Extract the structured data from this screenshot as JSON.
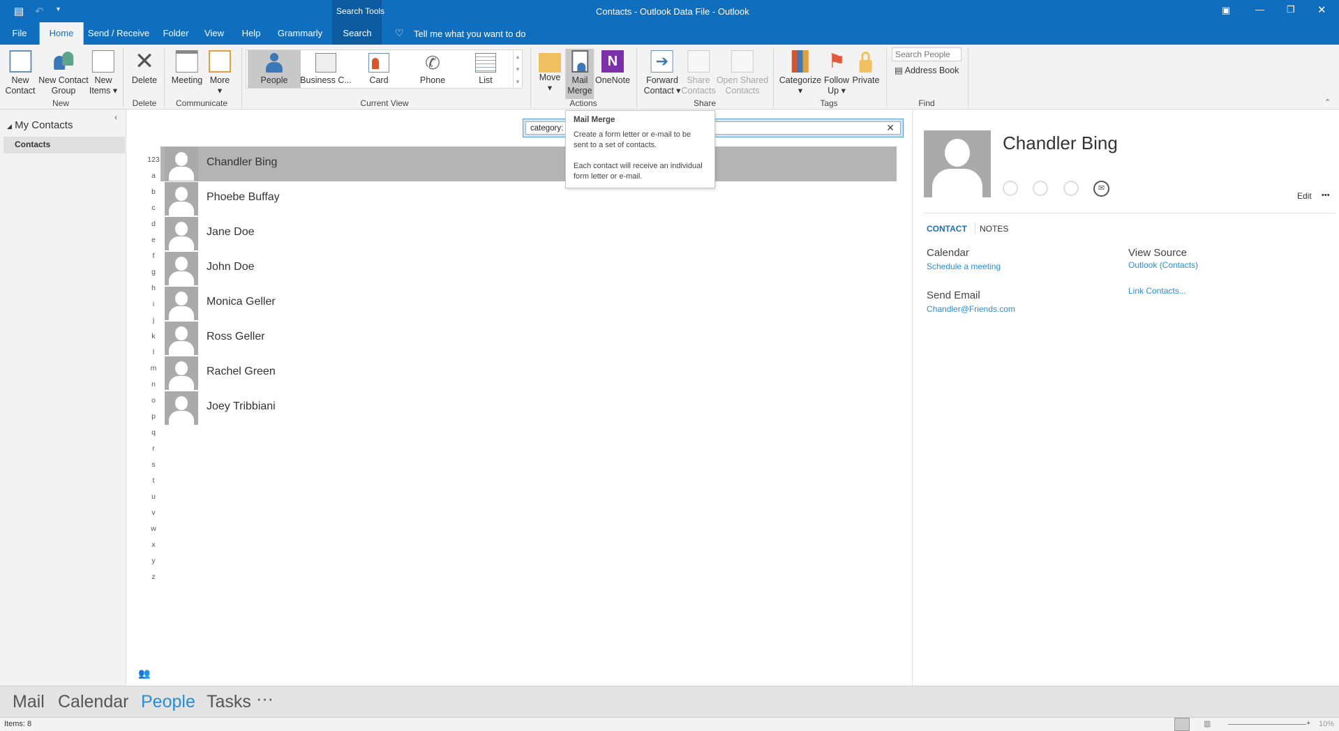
{
  "window": {
    "title": "Contacts - Outlook Data File  -  Outlook",
    "context_tab_group": "Search Tools"
  },
  "tabs": [
    {
      "label": "File"
    },
    {
      "label": "Home"
    },
    {
      "label": "Send / Receive"
    },
    {
      "label": "Folder"
    },
    {
      "label": "View"
    },
    {
      "label": "Help"
    },
    {
      "label": "Grammarly"
    },
    {
      "label": "Search"
    }
  ],
  "tell_me": "Tell me what you want to do",
  "ribbon": {
    "new": {
      "new_contact": "New\nContact",
      "new_contact_group": "New Contact\nGroup",
      "new_items": "New\nItems ▾",
      "label": "New"
    },
    "delete": {
      "delete": "Delete",
      "label": "Delete"
    },
    "communicate": {
      "meeting": "Meeting",
      "more": "More\n▾",
      "label": "Communicate"
    },
    "current_view": {
      "items": [
        "People",
        "Business C...",
        "Card",
        "Phone",
        "List"
      ],
      "selected": "People",
      "label": "Current View"
    },
    "actions": {
      "move": "Move\n▾",
      "mail_merge": "Mail\nMerge",
      "onenote": "OneNote",
      "label": "Actions"
    },
    "share": {
      "forward_contact": "Forward\nContact ▾",
      "share_contacts": "Share\nContacts",
      "open_shared": "Open Shared\nContacts",
      "label": "Share"
    },
    "tags": {
      "categorize": "Categorize\n▾",
      "follow_up": "Follow\nUp ▾",
      "private": "Private",
      "label": "Tags"
    },
    "find": {
      "search_placeholder": "Search People",
      "address_book": "Address Book",
      "label": "Find"
    }
  },
  "nav": {
    "group": "My Contacts",
    "folder": "Contacts"
  },
  "search": {
    "value": "category:"
  },
  "alphabet": [
    "123",
    "a",
    "b",
    "c",
    "d",
    "e",
    "f",
    "g",
    "h",
    "i",
    "j",
    "k",
    "l",
    "m",
    "n",
    "o",
    "p",
    "q",
    "r",
    "s",
    "t",
    "u",
    "v",
    "w",
    "x",
    "y",
    "z"
  ],
  "contacts": [
    {
      "name": "Chandler Bing"
    },
    {
      "name": "Phoebe Buffay"
    },
    {
      "name": "Jane Doe"
    },
    {
      "name": "John Doe"
    },
    {
      "name": "Monica Geller"
    },
    {
      "name": "Ross Geller"
    },
    {
      "name": "Rachel Green"
    },
    {
      "name": "Joey Tribbiani"
    }
  ],
  "tooltip": {
    "title": "Mail Merge",
    "line1": "Create a form letter or e-mail to be sent to a set of contacts.",
    "line2": "Each contact will receive an individual form letter or e-mail."
  },
  "reading": {
    "name": "Chandler Bing",
    "edit": "Edit",
    "more": "•••",
    "tab_contact": "CONTACT",
    "tab_notes": "NOTES",
    "calendar_label": "Calendar",
    "calendar_link": "Schedule a meeting",
    "email_label": "Send Email",
    "email": "Chandler@Friends.com",
    "source_label": "View Source",
    "source_link": "Outlook (Contacts)",
    "link_contacts": "Link Contacts..."
  },
  "bottom_nav": {
    "items": [
      "Mail",
      "Calendar",
      "People",
      "Tasks"
    ],
    "active": "People",
    "more": "···"
  },
  "status": {
    "items": "Items: 8",
    "zoom": "10%"
  },
  "colors": {
    "brand": "#106ebe",
    "link": "#2a8dd4",
    "selected_row": "#b4b4b4"
  }
}
